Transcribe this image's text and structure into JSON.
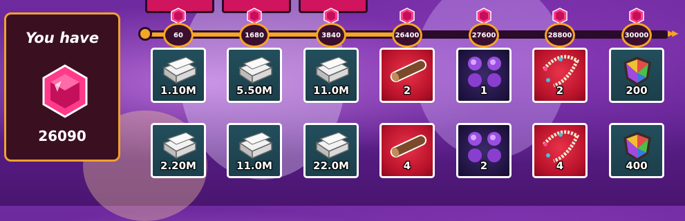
{
  "panel": {
    "title": "You have",
    "amount": "26090",
    "icon": "gem-icon"
  },
  "milestones": [
    {
      "label": "60"
    },
    {
      "label": "1680"
    },
    {
      "label": "3840"
    },
    {
      "label": "26400"
    },
    {
      "label": "27600"
    },
    {
      "label": "28800"
    },
    {
      "label": "30000"
    }
  ],
  "progress_fraction": 0.52,
  "rewards": {
    "row1": [
      {
        "icon": "silver-ingot-icon",
        "label": "1.10M"
      },
      {
        "icon": "silver-ingot-icon",
        "label": "5.50M"
      },
      {
        "icon": "silver-ingot-icon",
        "label": "11.0M"
      },
      {
        "icon": "wood-log-icon",
        "label": "2"
      },
      {
        "icon": "purple-fabric-icon",
        "label": "1"
      },
      {
        "icon": "pearl-necklace-icon",
        "label": "2"
      },
      {
        "icon": "rainbow-shield-gem-icon",
        "label": "200"
      }
    ],
    "row2": [
      {
        "icon": "silver-ingot-icon",
        "label": "2.20M"
      },
      {
        "icon": "silver-ingot-icon",
        "label": "11.0M"
      },
      {
        "icon": "silver-ingot-icon",
        "label": "22.0M"
      },
      {
        "icon": "wood-log-icon",
        "label": "4"
      },
      {
        "icon": "purple-fabric-icon",
        "label": "2"
      },
      {
        "icon": "pearl-necklace-icon",
        "label": "4"
      },
      {
        "icon": "rainbow-shield-gem-icon",
        "label": "400"
      }
    ]
  }
}
